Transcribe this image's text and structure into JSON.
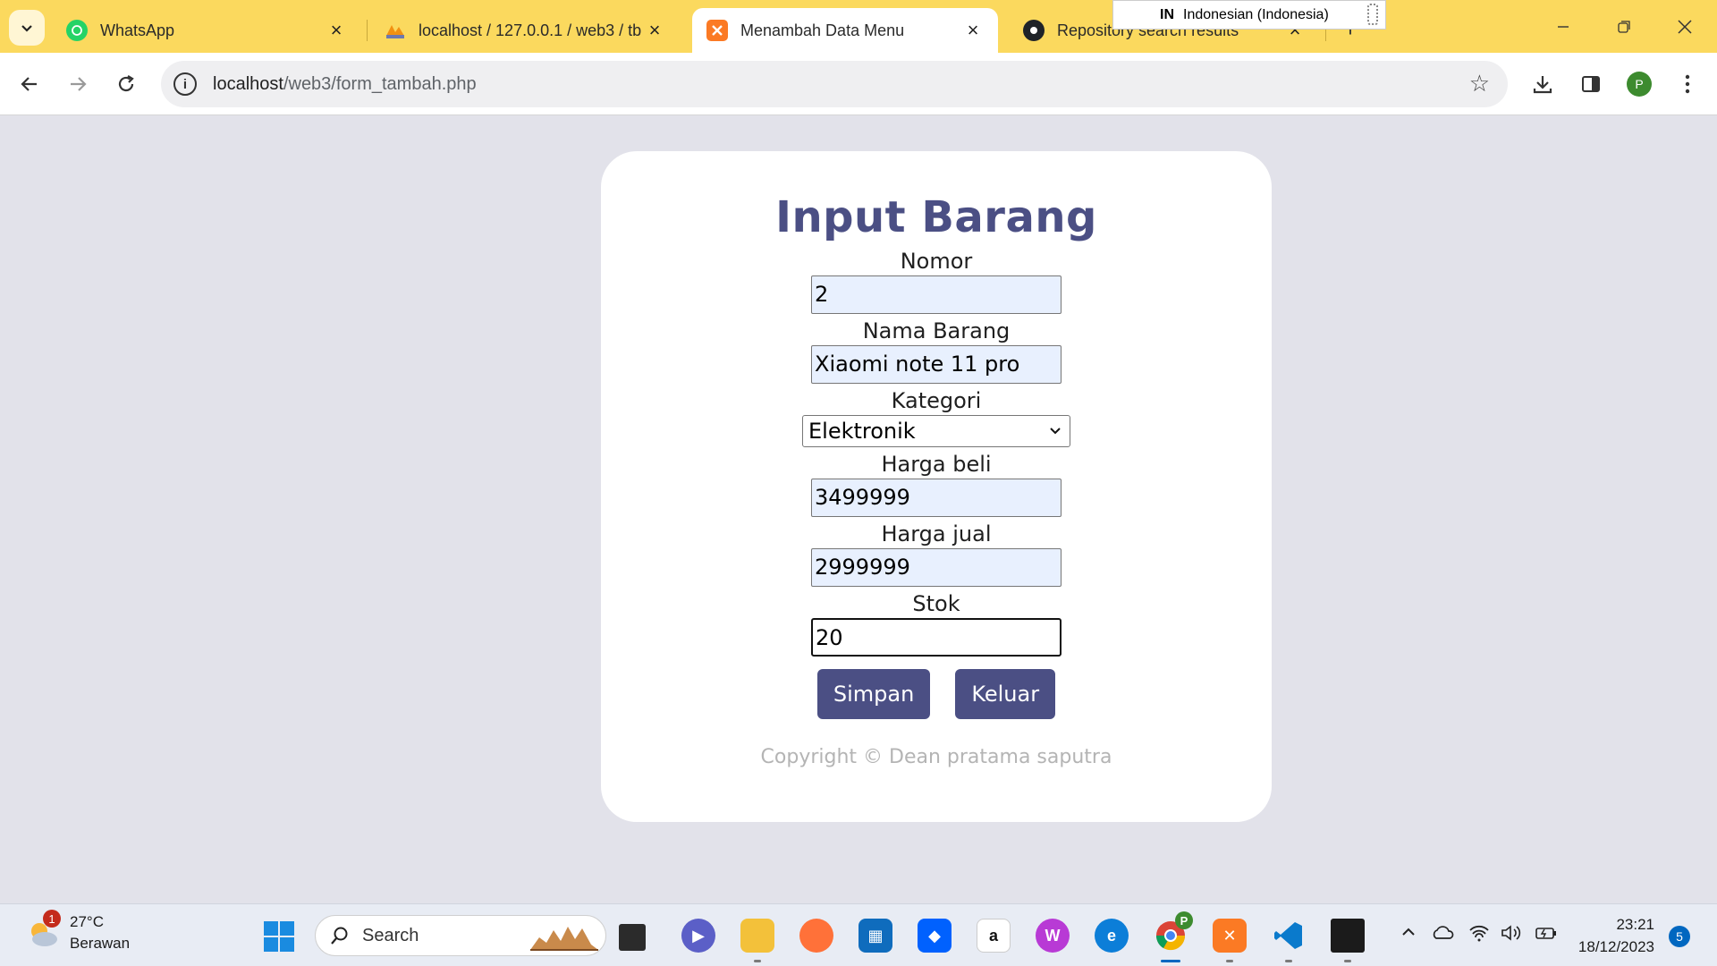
{
  "browser": {
    "tabs": [
      {
        "title": "WhatsApp",
        "icon": "whatsapp-icon",
        "active": false
      },
      {
        "title": "localhost / 127.0.0.1 / web3 / tb",
        "icon": "phpmyadmin-icon",
        "active": false
      },
      {
        "title": "Menambah Data Menu",
        "icon": "xampp-icon",
        "active": true
      },
      {
        "title": "Repository search results",
        "icon": "github-icon",
        "active": false
      }
    ],
    "language_popup": {
      "code": "IN",
      "name": "Indonesian (Indonesia)"
    },
    "address": {
      "host": "localhost",
      "path": "/web3/form_tambah.php"
    },
    "profile_initial": "P"
  },
  "form": {
    "title": "Input Barang",
    "fields": [
      {
        "label": "Nomor",
        "value": "2"
      },
      {
        "label": "Nama Barang",
        "value": "Xiaomi note 11 pro"
      },
      {
        "label": "Kategori",
        "value": "Elektronik"
      },
      {
        "label": "Harga beli",
        "value": "3499999"
      },
      {
        "label": "Harga jual",
        "value": "2999999"
      },
      {
        "label": "Stok",
        "value": "20"
      }
    ],
    "buttons": {
      "save": "Simpan",
      "exit": "Keluar"
    },
    "copyright": "Copyright © Dean pratama saputra"
  },
  "taskbar": {
    "weather": {
      "temp": "27°C",
      "condition": "Berawan",
      "badge": "1"
    },
    "search_label": "Search",
    "clock": {
      "time": "23:21",
      "date": "18/12/2023"
    },
    "notifications": "5",
    "chrome_badge": "P"
  },
  "colors": {
    "tab_strip": "#fbd95e",
    "accent": "#4b4f84",
    "page_bg": "#e2e2ea",
    "autofill": "#e8f0fe"
  }
}
